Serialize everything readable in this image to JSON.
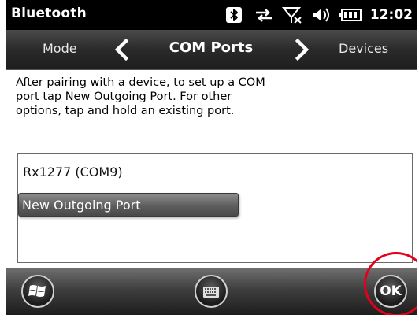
{
  "title_bar": {
    "app_title": "Bluetooth",
    "clock": "12:02",
    "icons": [
      "bluetooth-icon",
      "connectivity-icon",
      "signal-off-icon",
      "volume-icon",
      "battery-icon"
    ]
  },
  "header": {
    "prev_tab": "Mode",
    "current_tab": "COM Ports",
    "next_tab": "Devices"
  },
  "description": {
    "line1": "After pairing with a device, to set up a COM",
    "line2": "port tap New Outgoing Port. For other",
    "line3": "options, tap and hold an existing port."
  },
  "port_list": {
    "items": [
      "Rx1277 (COM9)"
    ],
    "new_port_label": "New Outgoing Port"
  },
  "bottom_bar": {
    "ok_label": "OK",
    "icons": [
      "windows-start-icon",
      "keyboard-icon"
    ]
  },
  "colors": {
    "annotation": "#e5001a",
    "title_bar_bg": "#000000",
    "text": "#000000"
  }
}
